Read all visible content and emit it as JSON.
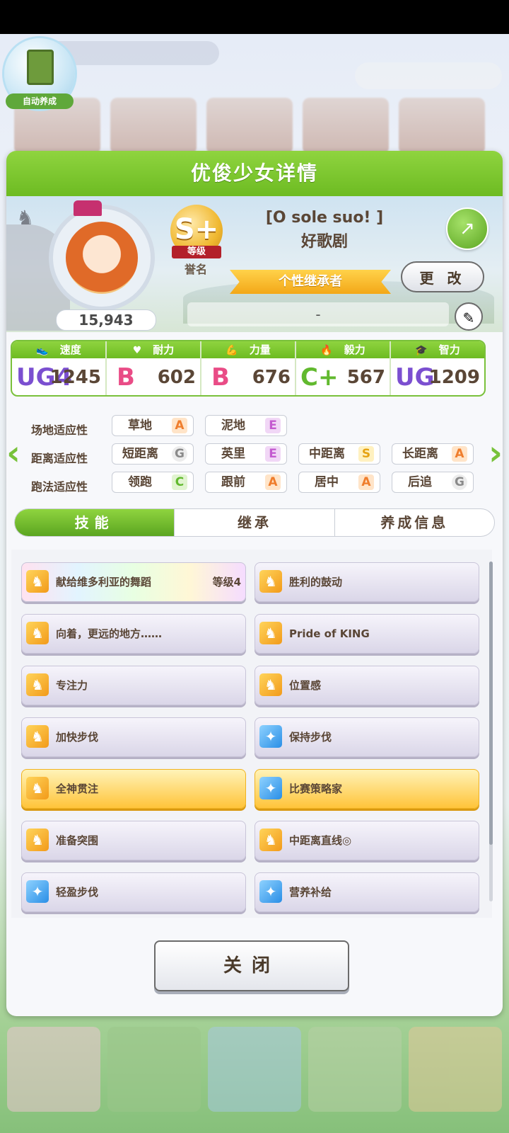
{
  "background": {
    "auto_label": "自动养成"
  },
  "panel": {
    "title": "优俊少女详情",
    "fans": "15,943",
    "rank_letter": "S+",
    "rank_ribbon": "等级",
    "rank_title": "誉名",
    "epithet": "[O sole suo! ]",
    "name": "好歌剧",
    "inherit_banner": "个性继承者",
    "change_label": "更 改",
    "note_value": "-",
    "icons": {
      "share": "share-icon",
      "edit": "pencil-icon",
      "trophy": "trophy-icon"
    }
  },
  "stats": [
    {
      "label": "速度",
      "icon": "shoe-icon",
      "rank": "UG4",
      "value": "1245"
    },
    {
      "label": "耐力",
      "icon": "heart-icon",
      "rank": "B",
      "value": "602"
    },
    {
      "label": "力量",
      "icon": "muscle-icon",
      "rank": "B",
      "value": "676"
    },
    {
      "label": "毅力",
      "icon": "flame-icon",
      "rank": "C+",
      "value": "567"
    },
    {
      "label": "智力",
      "icon": "cap-icon",
      "rank": "UG",
      "value": "1209"
    }
  ],
  "aptitude": {
    "track_label": "场地适应性",
    "distance_label": "距离适应性",
    "style_label": "跑法适应性",
    "track": [
      {
        "name": "草地",
        "grade": "A"
      },
      {
        "name": "泥地",
        "grade": "E"
      }
    ],
    "distance": [
      {
        "name": "短距离",
        "grade": "G"
      },
      {
        "name": "英里",
        "grade": "E"
      },
      {
        "name": "中距离",
        "grade": "S"
      },
      {
        "name": "长距离",
        "grade": "A"
      }
    ],
    "style": [
      {
        "name": "领跑",
        "grade": "C"
      },
      {
        "name": "跟前",
        "grade": "A"
      },
      {
        "name": "居中",
        "grade": "A"
      },
      {
        "name": "后追",
        "grade": "G"
      }
    ]
  },
  "tabs": [
    "技能",
    "继承",
    "养成信息"
  ],
  "skills": [
    {
      "name": "献给维多利亚的舞蹈",
      "level": "等级4",
      "style": "rainbow",
      "icon": "gold"
    },
    {
      "name": "胜利的鼓动",
      "level": "",
      "style": "normal",
      "icon": "gold"
    },
    {
      "name": "向着，更远的地方……",
      "level": "",
      "style": "normal",
      "icon": "gold"
    },
    {
      "name": "Pride of KING",
      "level": "",
      "style": "normal",
      "icon": "gold"
    },
    {
      "name": "专注力",
      "level": "",
      "style": "normal",
      "icon": "gold"
    },
    {
      "name": "位置感",
      "level": "",
      "style": "normal",
      "icon": "gold"
    },
    {
      "name": "加快步伐",
      "level": "",
      "style": "normal",
      "icon": "gold"
    },
    {
      "name": "保持步伐",
      "level": "",
      "style": "normal",
      "icon": "blue"
    },
    {
      "name": "全神贯注",
      "level": "",
      "style": "gold",
      "icon": "gold"
    },
    {
      "name": "比赛策略家",
      "level": "",
      "style": "gold",
      "icon": "blue"
    },
    {
      "name": "准备突围",
      "level": "",
      "style": "normal",
      "icon": "gold"
    },
    {
      "name": "中距离直线◎",
      "level": "",
      "style": "normal",
      "icon": "gold"
    },
    {
      "name": "轻盈步伐",
      "level": "",
      "style": "normal",
      "icon": "blue"
    },
    {
      "name": "营养补给",
      "level": "",
      "style": "normal",
      "icon": "blue"
    }
  ],
  "close_label": "关闭"
}
